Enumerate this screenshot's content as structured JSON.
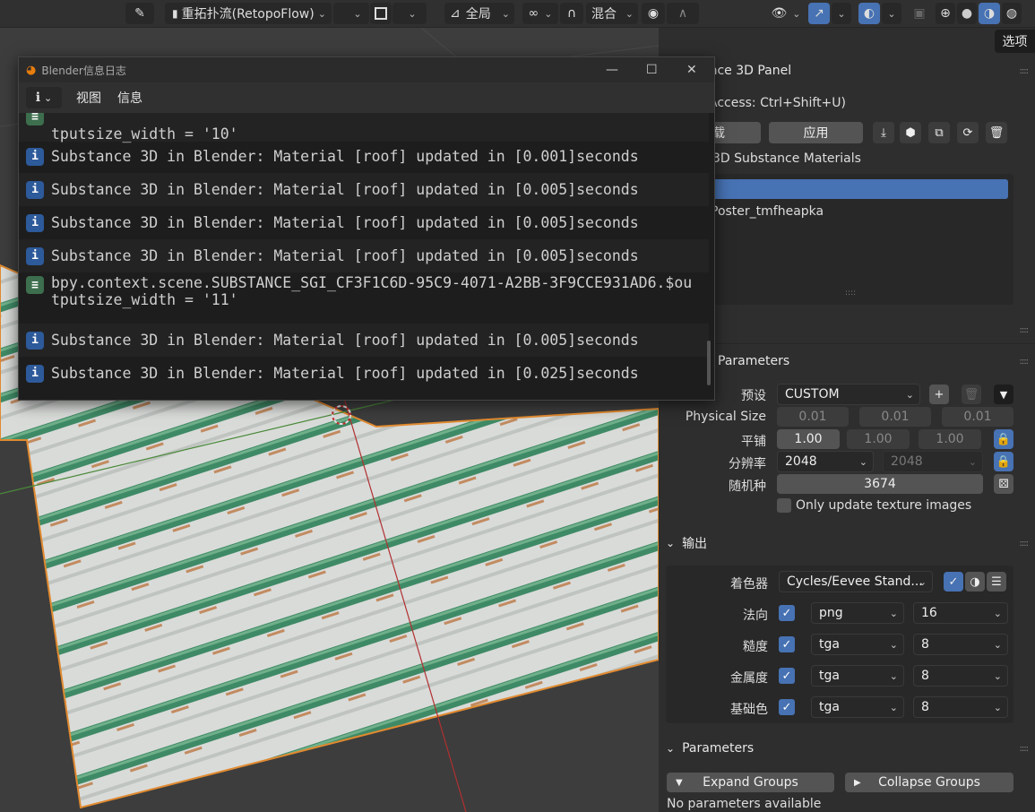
{
  "toolbar": {
    "retopo_label": "重拓扑流(RetopoFlow)",
    "transform_label": "全局",
    "blend_label": "混合",
    "options_label": "选项"
  },
  "log_window": {
    "title": "Blender信息日志",
    "menu_view": "视图",
    "menu_info": "信息",
    "entries": [
      {
        "type": "operator",
        "lines": [
          "tputsize_width = '10'"
        ]
      },
      {
        "type": "info",
        "lines": [
          "Substance 3D in Blender: Material [roof] updated in [0.001]seconds"
        ]
      },
      {
        "type": "info",
        "lines": [
          "Substance 3D in Blender: Material [roof] updated in [0.005]seconds"
        ]
      },
      {
        "type": "info",
        "lines": [
          "Substance 3D in Blender: Material [roof] updated in [0.005]seconds"
        ]
      },
      {
        "type": "info",
        "lines": [
          "Substance 3D in Blender: Material [roof] updated in [0.005]seconds"
        ]
      },
      {
        "type": "operator",
        "lines": [
          "bpy.context.scene.SUBSTANCE_SGI_CF3F1C6D-95C9-4071-A2BB-3F9CCE931AD6.$ou",
          "tputsize_width = '11'"
        ]
      },
      {
        "type": "info",
        "lines": [
          "Substance 3D in Blender: Material [roof] updated in [0.005]seconds"
        ]
      },
      {
        "type": "info",
        "lines": [
          "Substance 3D in Blender: Material [roof] updated in [0.025]seconds"
        ]
      }
    ]
  },
  "panel": {
    "title": "ance 3D Panel",
    "access": "Access: Ctrl+Shift+U)",
    "load_label": "载",
    "apply_label": "应用",
    "materials_header": "3D Substance Materials",
    "material_item": "Poster_tmfheapka",
    "params_header": "Parameters",
    "preset_label": "预设",
    "preset_value": "CUSTOM",
    "physical_size_label": "Physical Size",
    "physical_size": [
      "0.01",
      "0.01",
      "0.01"
    ],
    "tiling_label": "平铺",
    "tiling": [
      "1.00",
      "1.00",
      "1.00"
    ],
    "resolution_label": "分辨率",
    "resolution": [
      "2048",
      "2048"
    ],
    "seed_label": "随机种",
    "seed_value": "3674",
    "only_update_label": "Only update texture images",
    "output_header": "输出",
    "shader_label": "着色器",
    "shader_value": "Cycles/Eevee Stand...",
    "outputs": [
      {
        "label": "法向",
        "format": "png",
        "bits": "16"
      },
      {
        "label": "糙度",
        "format": "tga",
        "bits": "8"
      },
      {
        "label": "金属度",
        "format": "tga",
        "bits": "8"
      },
      {
        "label": "基础色",
        "format": "tga",
        "bits": "8"
      }
    ],
    "parameters_header": "Parameters",
    "expand_label": "Expand Groups",
    "collapse_label": "Collapse Groups",
    "no_params": "No parameters available"
  }
}
